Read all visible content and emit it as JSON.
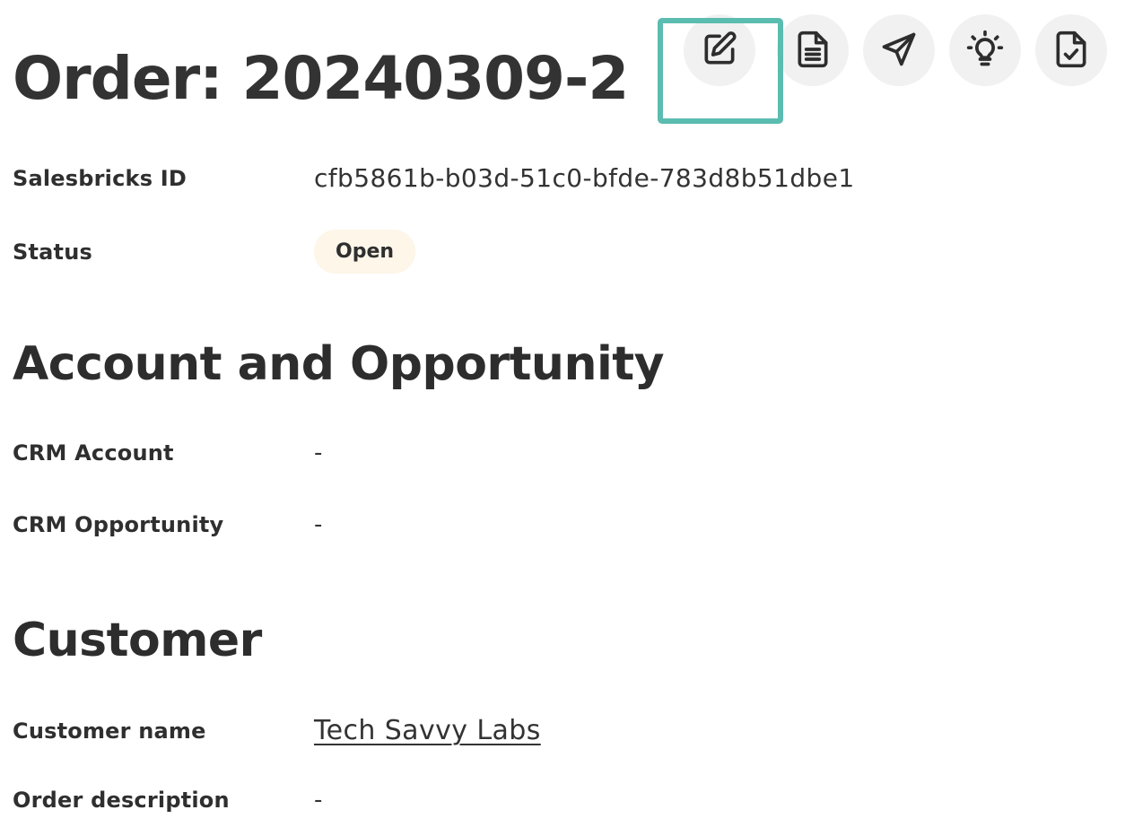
{
  "header": {
    "title": "Order: 20240309-2",
    "actions": [
      {
        "name": "edit",
        "icon": "edit-icon"
      },
      {
        "name": "document",
        "icon": "document-icon"
      },
      {
        "name": "send",
        "icon": "send-icon"
      },
      {
        "name": "insights",
        "icon": "lightbulb-icon"
      },
      {
        "name": "approve",
        "icon": "document-check-icon"
      }
    ],
    "highlight_color": "#5bbcb0"
  },
  "details": {
    "salesbricks_id_label": "Salesbricks ID",
    "salesbricks_id_value": "cfb5861b-b03d-51c0-bfde-783d8b51dbe1",
    "status_label": "Status",
    "status_value": "Open",
    "status_badge_color": "#fdf6e9"
  },
  "account_section": {
    "title": "Account and Opportunity",
    "crm_account_label": "CRM Account",
    "crm_account_value": "-",
    "crm_opportunity_label": "CRM Opportunity",
    "crm_opportunity_value": "-"
  },
  "customer_section": {
    "title": "Customer",
    "customer_name_label": "Customer name",
    "customer_name_value": "Tech Savvy Labs",
    "order_description_label": "Order description",
    "order_description_value": "-"
  }
}
